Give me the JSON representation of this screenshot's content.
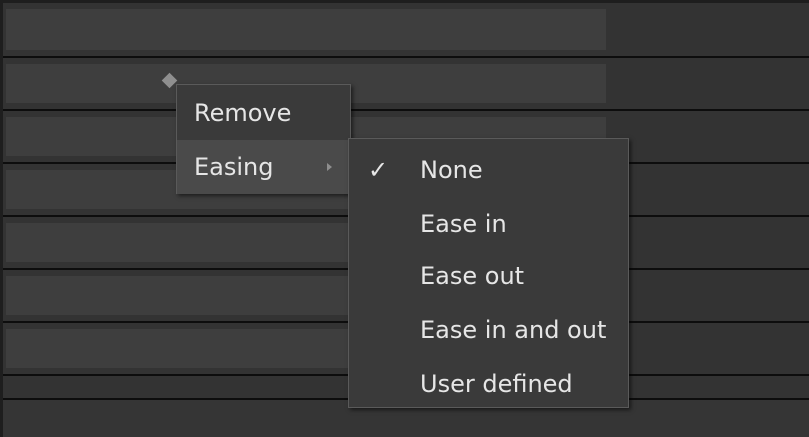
{
  "context_menu": {
    "items": [
      {
        "label": "Remove"
      },
      {
        "label": "Easing",
        "has_submenu": true
      }
    ]
  },
  "easing_submenu": {
    "check_mark": "✓",
    "selected": "None",
    "items": [
      {
        "label": "None",
        "checked": true
      },
      {
        "label": "Ease in",
        "checked": false
      },
      {
        "label": "Ease out",
        "checked": false
      },
      {
        "label": "Ease in and out",
        "checked": false
      },
      {
        "label": "User defined",
        "checked": false
      }
    ]
  },
  "colors": {
    "menu_background": "#3a3a3a",
    "menu_highlight": "#4a4a4a",
    "menu_text": "#e6e6e6",
    "track_background": "#333333",
    "track_bar": "#3e3e3e",
    "track_separator": "#0d0d0d",
    "keyframe": "#8f8f8f"
  },
  "icons": {
    "check": "check-icon",
    "submenu_arrow": "chevron-right-icon",
    "keyframe": "keyframe-diamond-icon"
  }
}
